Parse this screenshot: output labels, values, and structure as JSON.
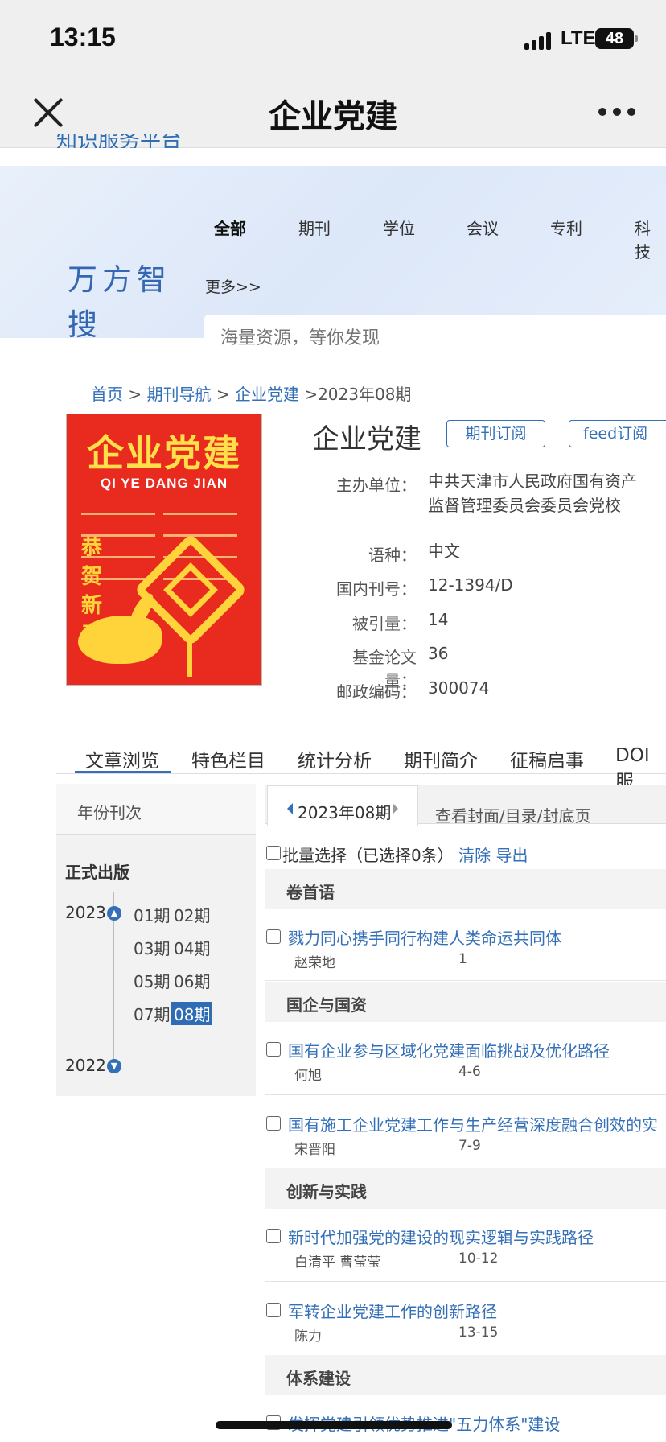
{
  "status": {
    "time": "13:15",
    "network": "LTE",
    "battery": "48"
  },
  "nav": {
    "title": "企业党建"
  },
  "clipped_header": "知识服务平台",
  "search": {
    "logo": "万方智搜",
    "tabs": [
      "全部",
      "期刊",
      "学位",
      "会议",
      "专利",
      "科技"
    ],
    "more": "更多>>",
    "placeholder": "海量资源，等你发现"
  },
  "breadcrumb": {
    "home": "首页",
    "sep": ">",
    "nav": "期刊导航",
    "journal": "企业党建",
    "current": ">2023年08期"
  },
  "cover": {
    "title": "企业党建",
    "subtitle": "QI YE DANG JIAN",
    "greeting": "恭贺新春"
  },
  "journal": {
    "title": "企业党建",
    "subscribe": "期刊订阅",
    "feed": "feed订阅",
    "info": [
      {
        "label": "主办单位：",
        "value": "中共天津市人民政府国有资产",
        "value2": "监督管理委员会委员会党校"
      },
      {
        "label": "语种：",
        "value": "中文"
      },
      {
        "label": "国内刊号：",
        "value": "12-1394/D"
      },
      {
        "label": "被引量：",
        "value": "14"
      },
      {
        "label": "基金论文量：",
        "value": "36"
      },
      {
        "label": "邮政编码：",
        "value": "300074"
      }
    ]
  },
  "main_tabs": [
    "文章浏览",
    "特色栏目",
    "统计分析",
    "期刊简介",
    "征稿启事",
    "DOI服"
  ],
  "left_panel": {
    "head": "年份刊次",
    "official": "正式出版",
    "years": [
      {
        "year": "2023",
        "issues": [
          [
            "01期",
            "02期"
          ],
          [
            "03期",
            "04期"
          ],
          [
            "05期",
            "06期"
          ],
          [
            "07期",
            "08期"
          ]
        ]
      },
      {
        "year": "2022"
      }
    ]
  },
  "issue_tabs": {
    "active": "2023年08期",
    "other": "查看封面/目录/封底页"
  },
  "batch": {
    "label": "批量选择（已选择0条）",
    "clear": "清除",
    "export": "导出"
  },
  "sections": [
    {
      "name": "卷首语",
      "articles": [
        {
          "title": "戮力同心携手同行构建人类命运共同体",
          "author": "赵荣地",
          "pages": "1"
        }
      ]
    },
    {
      "name": "国企与国资",
      "articles": [
        {
          "title": "国有企业参与区域化党建面临挑战及优化路径",
          "author": "何旭",
          "pages": "4-6"
        },
        {
          "title": "国有施工企业党建工作与生产经营深度融合创效的实",
          "author": "宋晋阳",
          "pages": "7-9"
        }
      ]
    },
    {
      "name": "创新与实践",
      "articles": [
        {
          "title": "新时代加强党的建设的现实逻辑与实践路径",
          "author": "白清平 曹莹莹",
          "pages": "10-12"
        },
        {
          "title": "军转企业党建工作的创新路径",
          "author": "陈力",
          "pages": "13-15"
        }
      ]
    },
    {
      "name": "体系建设",
      "articles": [
        {
          "title": "发挥党建引领优势推进\"五力体系\"建设",
          "author": "",
          "pages": ""
        }
      ]
    }
  ]
}
